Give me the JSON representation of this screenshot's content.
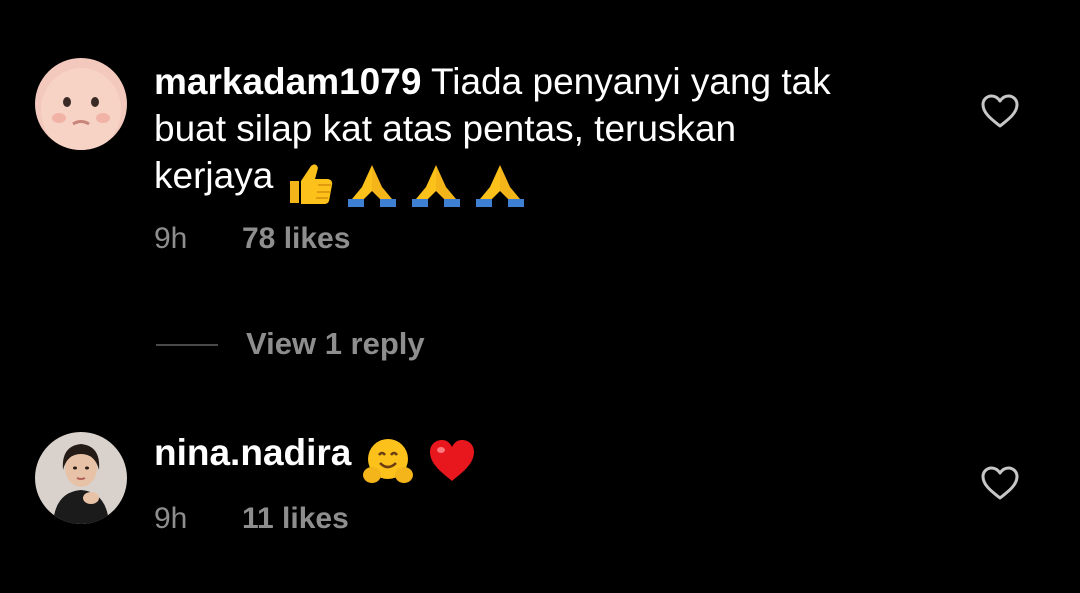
{
  "comments": [
    {
      "username": "markadam1079",
      "text_line1": " Tiada penyanyi yang tak",
      "text_line2": "buat silap kat atas pentas, teruskan",
      "text_line3": "kerjaya ",
      "emojis": [
        "thumbs-up",
        "folded-hands",
        "folded-hands",
        "folded-hands"
      ],
      "time": "9h",
      "likes": "78 likes",
      "view_replies": "View 1 reply"
    },
    {
      "username": "nina.nadira",
      "emojis": [
        "hugging-face",
        "red-heart"
      ],
      "time": "9h",
      "likes": "11 likes"
    }
  ],
  "colors": {
    "background": "#000000",
    "text": "#ffffff",
    "muted": "#8e8e8e"
  },
  "icons": {
    "like": "heart-outline-icon"
  }
}
